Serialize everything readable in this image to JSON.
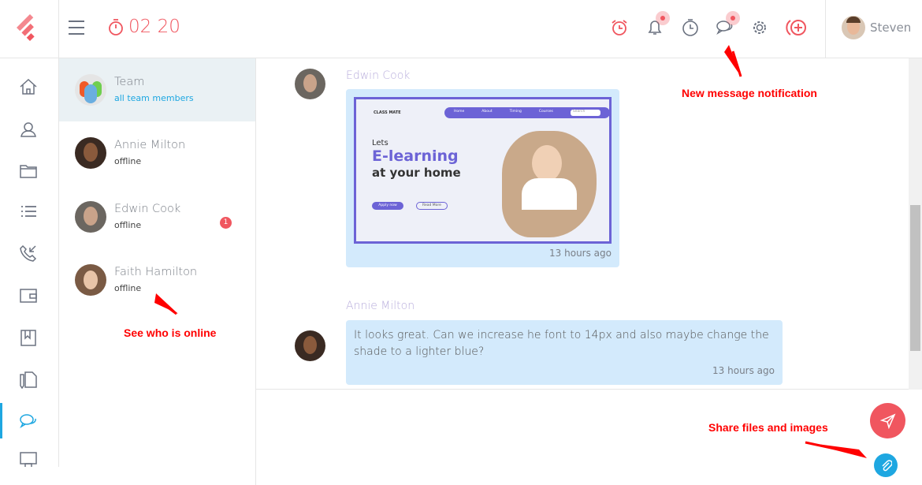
{
  "header": {
    "timer": "02 20",
    "username": "Steven",
    "icons": [
      "alarm-icon",
      "bell-icon",
      "stopwatch-icon",
      "chat-icon",
      "gear-icon",
      "add-circle-icon"
    ]
  },
  "sidebar": {
    "items": [
      "home",
      "contacts",
      "folder",
      "list",
      "calls",
      "wallet",
      "bookmark",
      "documents",
      "chat",
      "presentation"
    ],
    "active": "chat"
  },
  "contacts": [
    {
      "name": "Team",
      "status": "all team members"
    },
    {
      "name": "Annie Milton",
      "status": "offline"
    },
    {
      "name": "Edwin Cook",
      "status": "offline",
      "unread": "1"
    },
    {
      "name": "Faith Hamilton",
      "status": "offline"
    }
  ],
  "messages": [
    {
      "author": "Edwin Cook",
      "type": "image",
      "time": "13 hours ago",
      "image_text": {
        "logo": "CLASS MATE",
        "nav": [
          "Home",
          "About",
          "Timing",
          "Courses"
        ],
        "search": "Search",
        "line1": "Lets",
        "line2": "E-learning",
        "line3": "at your home",
        "btn1": "Apply now",
        "btn2": "Read More"
      }
    },
    {
      "author": "Annie Milton",
      "type": "text",
      "text": "It looks great. Can we increase he font to 14px and also maybe change the shade to a lighter blue?",
      "time": "13 hours ago"
    }
  ],
  "annotations": {
    "notification": "New message notification",
    "online": "See who is online",
    "share": "Share files and images"
  },
  "colors": {
    "accent": "#f0565f",
    "active": "#1ea7e1",
    "bubble": "#d3eafc"
  }
}
